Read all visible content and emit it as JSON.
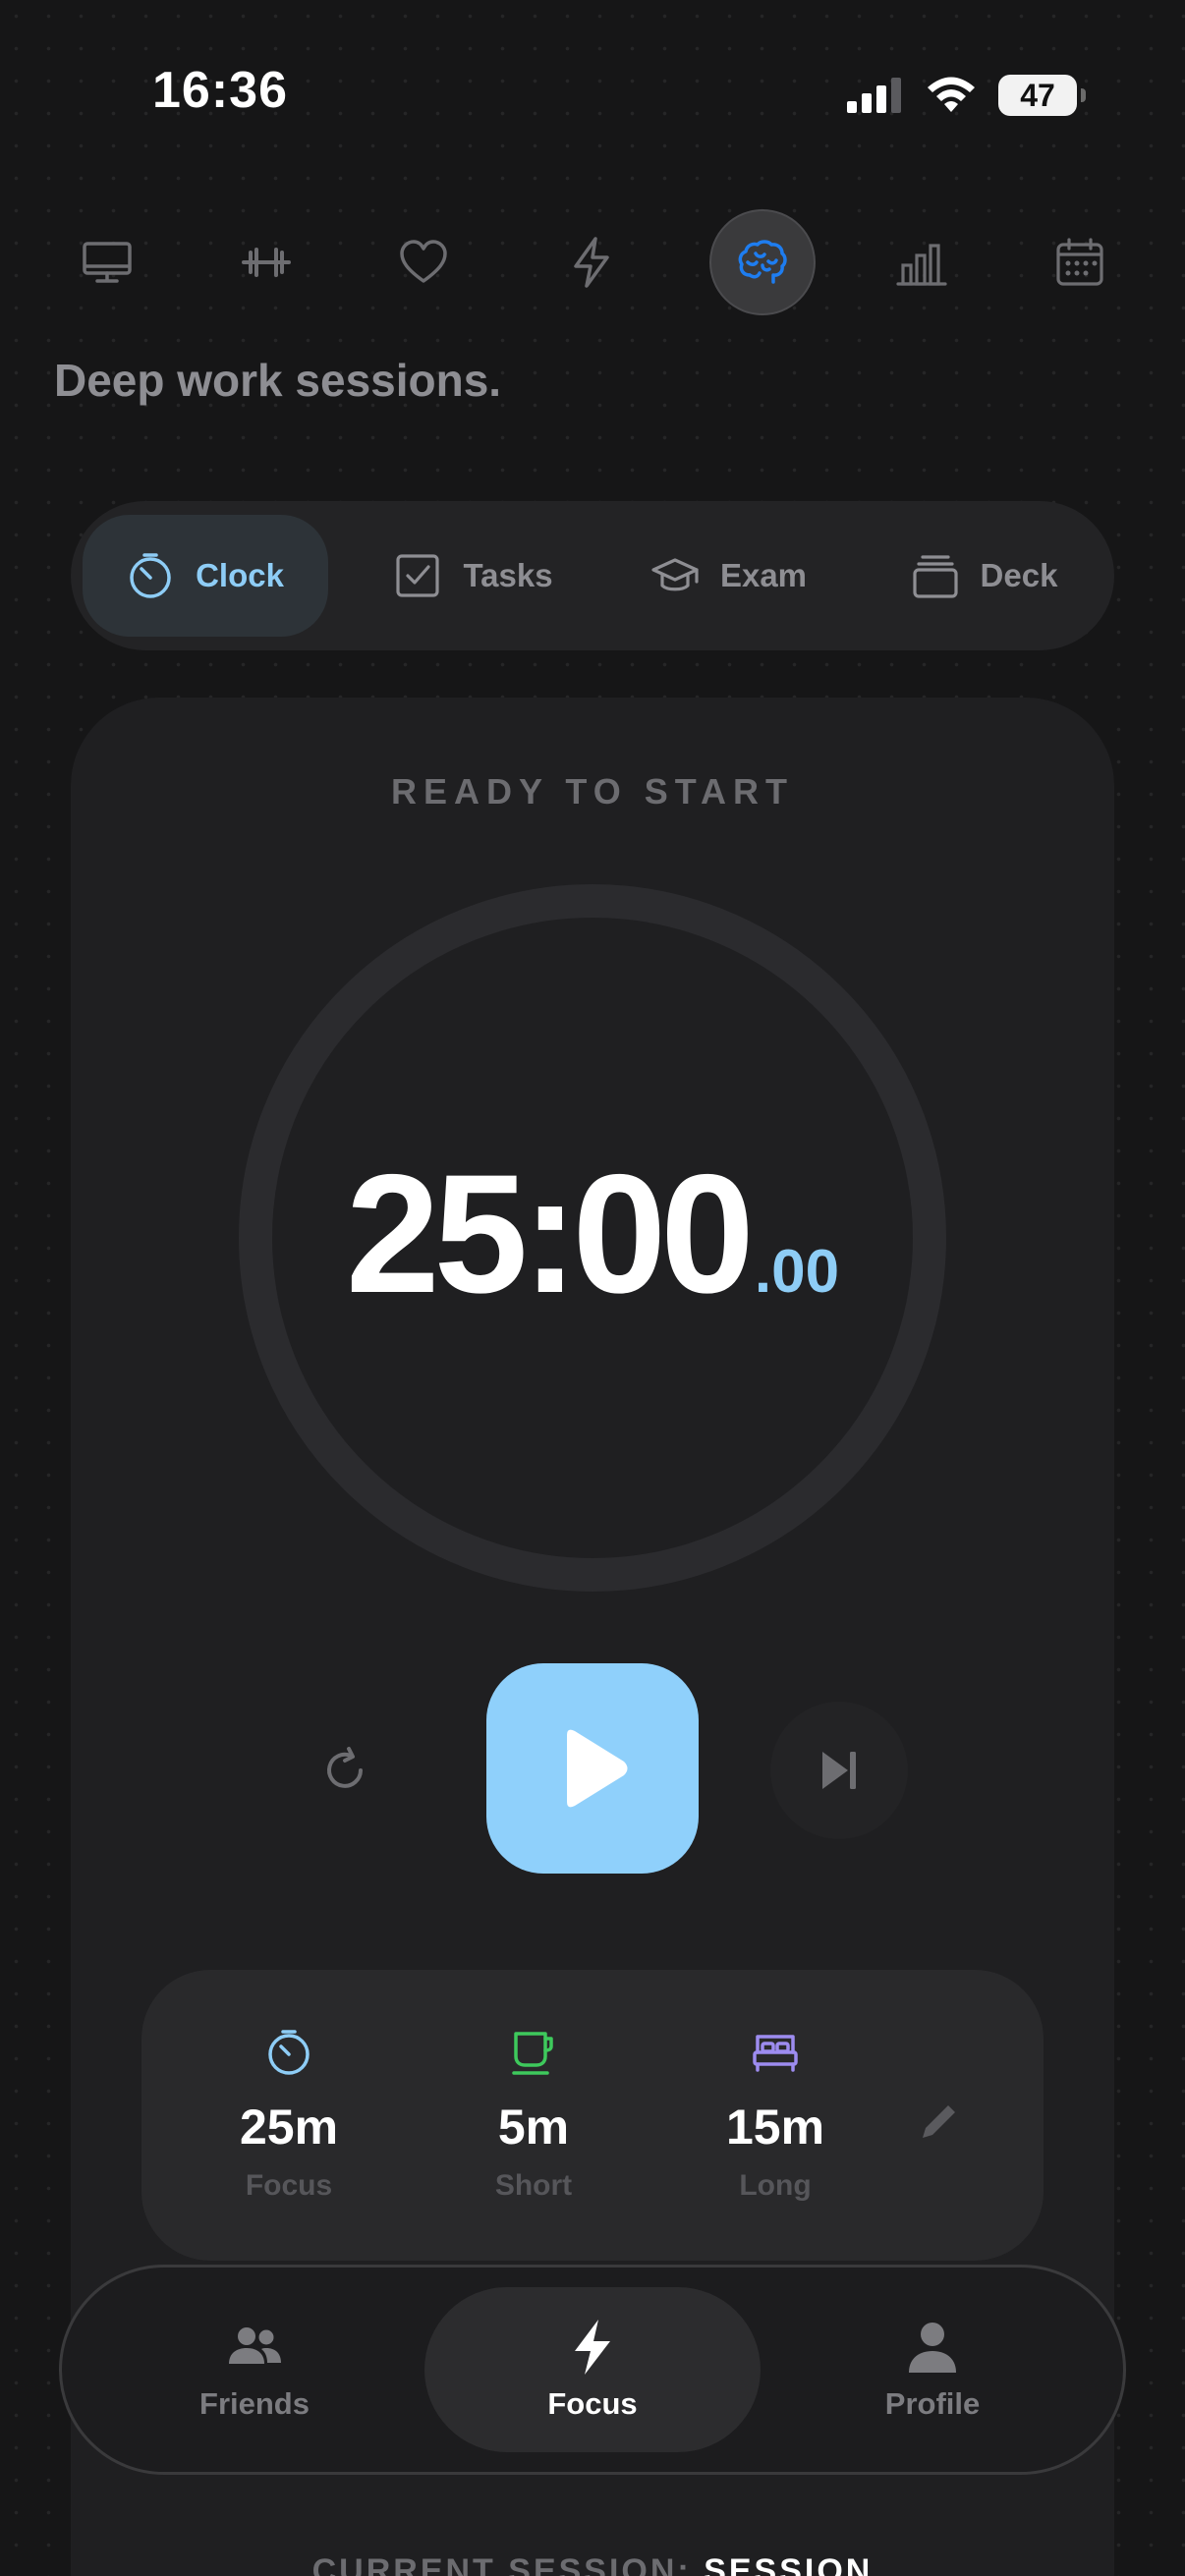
{
  "status_bar": {
    "time": "16:36",
    "battery": "47"
  },
  "top_nav": {
    "items": [
      {
        "icon": "monitor-icon",
        "active": false
      },
      {
        "icon": "dumbbell-icon",
        "active": false
      },
      {
        "icon": "heart-icon",
        "active": false
      },
      {
        "icon": "lightning-icon",
        "active": false
      },
      {
        "icon": "brain-icon",
        "active": true
      },
      {
        "icon": "bar-chart-icon",
        "active": false
      },
      {
        "icon": "calendar-icon",
        "active": false
      }
    ]
  },
  "tagline": "Deep work sessions.",
  "mode_tabs": {
    "items": [
      {
        "label": "Clock",
        "icon": "stopwatch-icon",
        "active": true
      },
      {
        "label": "Tasks",
        "icon": "checkbox-icon",
        "active": false
      },
      {
        "label": "Exam",
        "icon": "graduation-cap-icon",
        "active": false
      },
      {
        "label": "Deck",
        "icon": "card-stack-icon",
        "active": false
      }
    ]
  },
  "timer": {
    "status": "READY TO START",
    "main": "25:00",
    "fraction": ".00"
  },
  "controls": {
    "reset_icon": "reset-icon",
    "play_icon": "play-icon",
    "skip_icon": "skip-forward-icon"
  },
  "presets": {
    "items": [
      {
        "value": "25m",
        "label": "Focus",
        "icon": "stopwatch-icon",
        "color": "#8ecdf6"
      },
      {
        "value": "5m",
        "label": "Short",
        "icon": "coffee-cup-icon",
        "color": "#3ec95c"
      },
      {
        "value": "15m",
        "label": "Long",
        "icon": "bed-icon",
        "color": "#9d8cf0"
      }
    ],
    "edit_icon": "pencil-icon"
  },
  "bottom_tabs": {
    "items": [
      {
        "label": "Friends",
        "icon": "friends-icon",
        "active": false
      },
      {
        "label": "Focus",
        "icon": "lightning-icon",
        "active": true
      },
      {
        "label": "Profile",
        "icon": "profile-icon",
        "active": false
      }
    ]
  },
  "session_footer": {
    "prefix": "CURRENT SESSION:",
    "value": "SESSION"
  },
  "colors": {
    "accent": "#8fd0fb",
    "brain_active": "#1e7df0",
    "background": "#161617",
    "card": "#1f1f21"
  }
}
